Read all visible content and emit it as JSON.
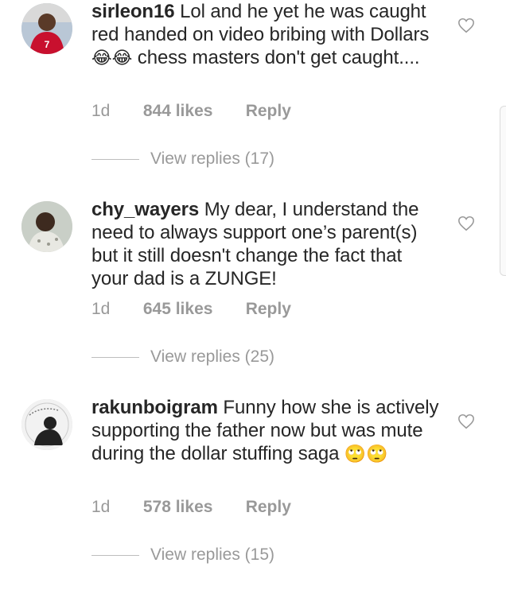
{
  "comments": [
    {
      "username": "sirleon16",
      "text": "Lol and he yet he was caught red handed on video bribing with Dollars",
      "emoji": "😂😂",
      "text_after": "chess masters don't get caught....",
      "time": "1d",
      "likes": "844 likes",
      "reply": "Reply",
      "view_replies": "View replies (17)"
    },
    {
      "username": "chy_wayers",
      "text": "My dear, I understand the need to always support one’s parent(s) but it still doesn't change the fact that your dad is a ZUNGE!",
      "emoji": "",
      "text_after": "",
      "time": "1d",
      "likes": "645 likes",
      "reply": "Reply",
      "view_replies": "View replies (25)"
    },
    {
      "username": "rakunboigram",
      "text": "Funny how she is actively supporting the father now but was mute during the dollar stuffing saga",
      "emoji": "🙄🙄",
      "text_after": "",
      "time": "1d",
      "likes": "578 likes",
      "reply": "Reply",
      "view_replies": "View replies (15)"
    }
  ],
  "icons": {
    "like": "heart-outline-icon"
  },
  "colors": {
    "text": "#262626",
    "secondary": "#999999"
  }
}
